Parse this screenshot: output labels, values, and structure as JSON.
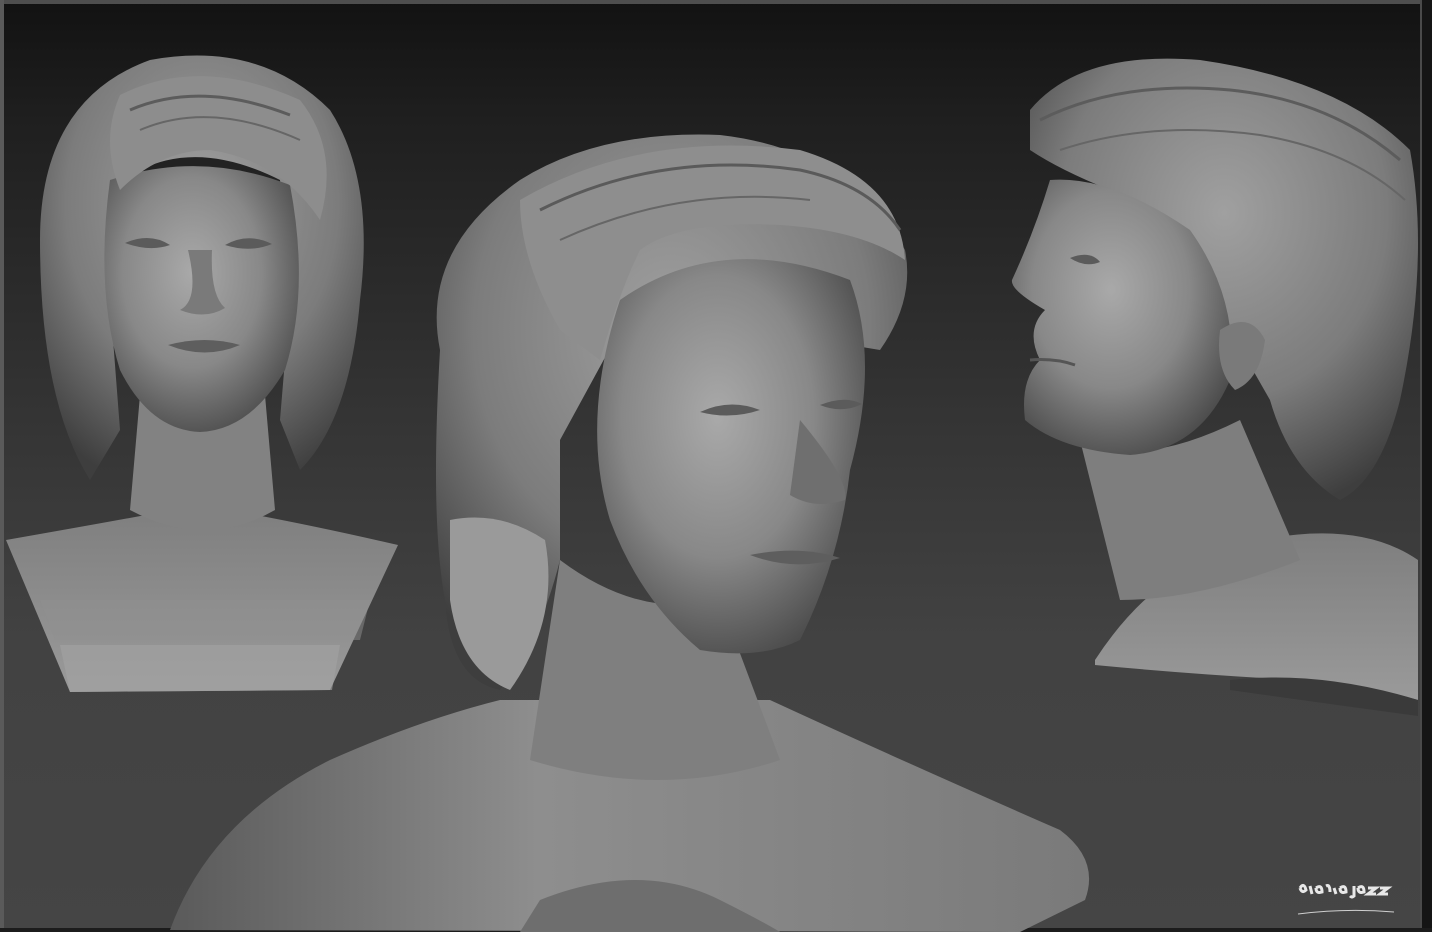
{
  "scene": {
    "description_alt": "",
    "background": {
      "top": "#121212",
      "bottom": "#454545"
    },
    "clay_color": "#8a8a8a",
    "views": [
      {
        "id": "front-view"
      },
      {
        "id": "three-quarter-view"
      },
      {
        "id": "profile-view"
      }
    ]
  },
  "signature": {
    "text": "dario jazz"
  }
}
